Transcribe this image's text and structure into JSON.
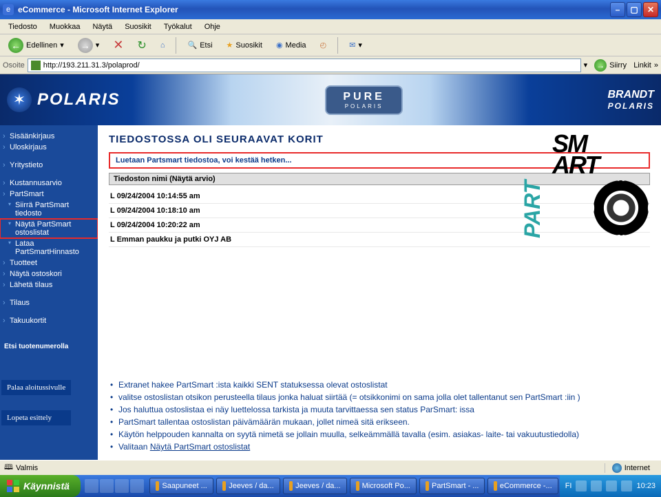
{
  "window": {
    "title": "eCommerce - Microsoft Internet Explorer"
  },
  "menu": [
    "Tiedosto",
    "Muokkaa",
    "Näytä",
    "Suosikit",
    "Työkalut",
    "Ohje"
  ],
  "toolbar": {
    "back": "Edellinen",
    "search": "Etsi",
    "favs": "Suosikit",
    "media": "Media"
  },
  "address": {
    "label": "Osoite",
    "url": "http://193.211.31.3/polaprod/",
    "go": "Siirry",
    "links": "Linkit"
  },
  "banner": {
    "polaris": "POLARIS",
    "pure": "PURE",
    "pure_sub": "POLARIS",
    "brandt1": "BRANDT",
    "brandt2": "POLARIS"
  },
  "sidebar": {
    "items": [
      "Sisäänkirjaus",
      "Uloskirjaus",
      "Yritystieto",
      "Kustannusarvio",
      "PartSmart",
      "Siirrä PartSmart tiedosto",
      "Näytä PartSmart ostoslistat",
      "Lataa PartSmartHinnasto",
      "Tuotteet",
      "Näytä ostoskori",
      "Lähetä tilaus",
      "Tilaus",
      "Takuukortit"
    ],
    "search_label": "Etsi tuotenumerolla"
  },
  "content": {
    "heading": "TIEDOSTOSSA OLI SEURAAVAT KORIT",
    "loading_msg": "Luetaan Partsmart tiedostoa, voi kestää hetken...",
    "subheader": "Tiedoston nimi (Näytä arvio)",
    "files": [
      "L 09/24/2004 10:14:55 am",
      "L 09/24/2004 10:18:10 am",
      "L 09/24/2004 10:20:22 am",
      "L Emman paukku ja putki OYJ AB"
    ]
  },
  "smart": {
    "line1": "SM",
    "line2": "ART",
    "part": "PART"
  },
  "overlay": {
    "btn1": "Palaa aloitussivulle",
    "btn2": "Lopeta esittely",
    "bullets": [
      "Extranet hakee PartSmart :ista kaikki SENT statuksessa olevat ostoslistat",
      "valitse ostoslistan otsikon perusteella tilaus jonka haluat siirtää (= otsikkonimi on sama jolla olet tallentanut sen PartSmart :iin )",
      "Jos haluttua ostoslistaa ei näy luettelossa tarkista ja muuta tarvittaessa sen status ParSmart: issa",
      "PartSmart tallentaa ostoslistan päivämäärän mukaan, jollet nimeä sitä erikseen.",
      "Käytön helppouden kannalta on syytä nimetä se jollain muulla, selkeämmällä tavalla (esim. asiakas- laite- tai vakuutustiedolla)",
      "Valitaan "
    ],
    "link": "Näytä PartSmart ostoslistat"
  },
  "status": {
    "done": "Valmis",
    "zone": "Internet"
  },
  "taskbar": {
    "start": "Käynnistä",
    "tasks": [
      "Saapuneet ...",
      "Jeeves / da...",
      "Jeeves / da...",
      "Microsoft Po...",
      "PartSmart - ...",
      "eCommerce -..."
    ],
    "lang": "FI",
    "time": "10:23"
  }
}
